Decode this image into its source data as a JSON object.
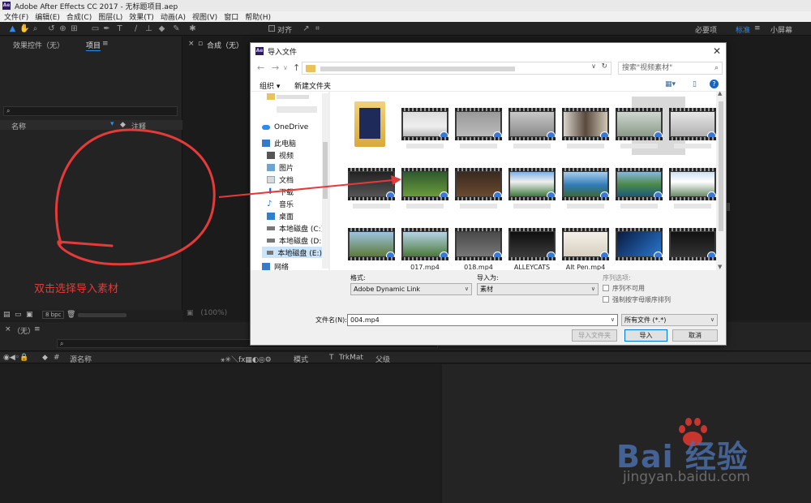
{
  "app": {
    "title": "Adobe After Effects CC 2017 - 无标题项目.aep",
    "logo": "Ae",
    "menu": [
      "文件(F)",
      "编辑(E)",
      "合成(C)",
      "图层(L)",
      "效果(T)",
      "动画(A)",
      "视图(V)",
      "窗口",
      "帮助(H)"
    ]
  },
  "toolbar": {
    "align_label": "对齐",
    "workspaces": [
      "必要项",
      "标准",
      "小屏幕"
    ],
    "active_workspace": "标准"
  },
  "left_panel": {
    "tabs": [
      "效果控件（无）",
      "项目"
    ],
    "tab_menu": "≡",
    "columns": [
      "名称",
      "注释"
    ],
    "bpc": "8 bpc"
  },
  "comp_panel": {
    "tab": "合成（无）",
    "zoom": "(100%)"
  },
  "timeline": {
    "tab": "（无）",
    "col_source": "源名称",
    "col_mode": "模式",
    "col_t": "T",
    "col_trkmat": "TrkMat",
    "col_parent": "父级"
  },
  "dialog": {
    "title": "导入文件",
    "search_placeholder": "搜索\"视频素材\"",
    "organize": "组织 ▾",
    "new_folder": "新建文件夹",
    "nav_items": [
      "OneDrive",
      "此电脑",
      "视频",
      "图片",
      "文档",
      "下载",
      "音乐",
      "桌面",
      "本地磁盘 (C:)",
      "本地磁盘 (D:)",
      "本地磁盘 (E:)",
      "网络"
    ],
    "file_rows": [
      {
        "tiles": [
          "folder",
          "kitchen",
          "room",
          "office",
          "woman-portrait",
          "woman-room",
          "living-room"
        ]
      },
      {
        "tiles": [
          "keyboard",
          "aerial-green",
          "man-dark",
          "mountain-lake",
          "blue-lake",
          "green-river",
          "snow-mountain"
        ]
      },
      {
        "tiles": [
          "hills",
          "forest",
          "dim-room",
          "dark-scene",
          "bright-pen",
          "blue-tech",
          "dark-screen"
        ]
      }
    ],
    "visible_labels": [
      "017.mp4",
      "018.mp4",
      "ALLEYCATS",
      "Alt Pen.mp4"
    ],
    "format_label": "格式:",
    "format_value": "Adobe Dynamic Link",
    "import_as_label": "导入为:",
    "import_as_value": "素材",
    "sequence_label": "序列选项:",
    "sequence_unavailable": "序列不可用",
    "force_alpha": "强制按字母顺序排列",
    "filename_label": "文件名(N):",
    "filename_value": "004.mp4",
    "filetype_value": "所有文件 (*.*)",
    "import_folder_btn": "导入文件夹",
    "import_btn": "导入",
    "cancel_btn": "取消"
  },
  "annotation": {
    "text": "双击选择导入素材",
    "color": "#e53a3a"
  },
  "watermark": {
    "brand": "Bai 经验",
    "url": "jingyan.baidu.com"
  },
  "colors": {
    "accent": "#2d8ceb",
    "panel_bg": "#232323",
    "dialog_bg": "#f0f0f0"
  }
}
